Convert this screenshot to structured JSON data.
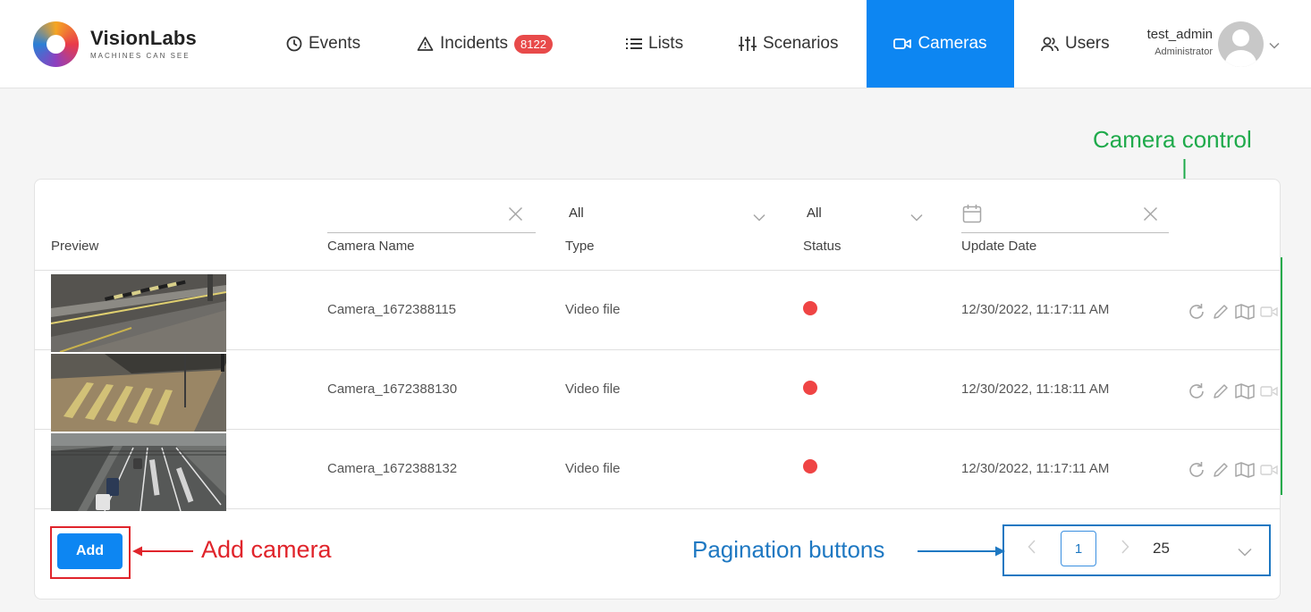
{
  "brand": {
    "name": "VisionLabs",
    "tagline": "MACHINES CAN SEE"
  },
  "nav": {
    "events": "Events",
    "incidents": "Incidents",
    "incidents_badge": "8122",
    "lists": "Lists",
    "scenarios": "Scenarios",
    "cameras": "Cameras",
    "users": "Users"
  },
  "user": {
    "name": "test_admin",
    "role": "Administrator"
  },
  "filters": {
    "camera_name_value": "",
    "type_value": "All",
    "status_value": "All",
    "date_value": ""
  },
  "table": {
    "headers": {
      "preview": "Preview",
      "name": "Camera Name",
      "type": "Type",
      "status": "Status",
      "date": "Update Date"
    },
    "rows": [
      {
        "name": "Camera_1672388115",
        "type": "Video file",
        "status_color": "#ef4444",
        "date": "12/30/2022, 11:17:11 AM"
      },
      {
        "name": "Camera_1672388130",
        "type": "Video file",
        "status_color": "#ef4444",
        "date": "12/30/2022, 11:18:11 AM"
      },
      {
        "name": "Camera_1672388132",
        "type": "Video file",
        "status_color": "#ef4444",
        "date": "12/30/2022, 11:17:11 AM"
      }
    ],
    "row_actions": [
      "restart-icon",
      "edit-icon",
      "map-icon",
      "video-camera-icon"
    ]
  },
  "footer": {
    "add_label": "Add"
  },
  "pagination": {
    "current_page": "1",
    "page_size": "25"
  },
  "annotations": {
    "camera_control": "Camera control",
    "add_camera": "Add camera",
    "pagination_buttons": "Pagination buttons"
  },
  "colors": {
    "accent": "#0d86f2",
    "badge": "#e84a4a",
    "status_error": "#ef4444",
    "annotation_green": "#1faa4b",
    "annotation_red": "#e0242b",
    "annotation_blue": "#1e78c2"
  }
}
